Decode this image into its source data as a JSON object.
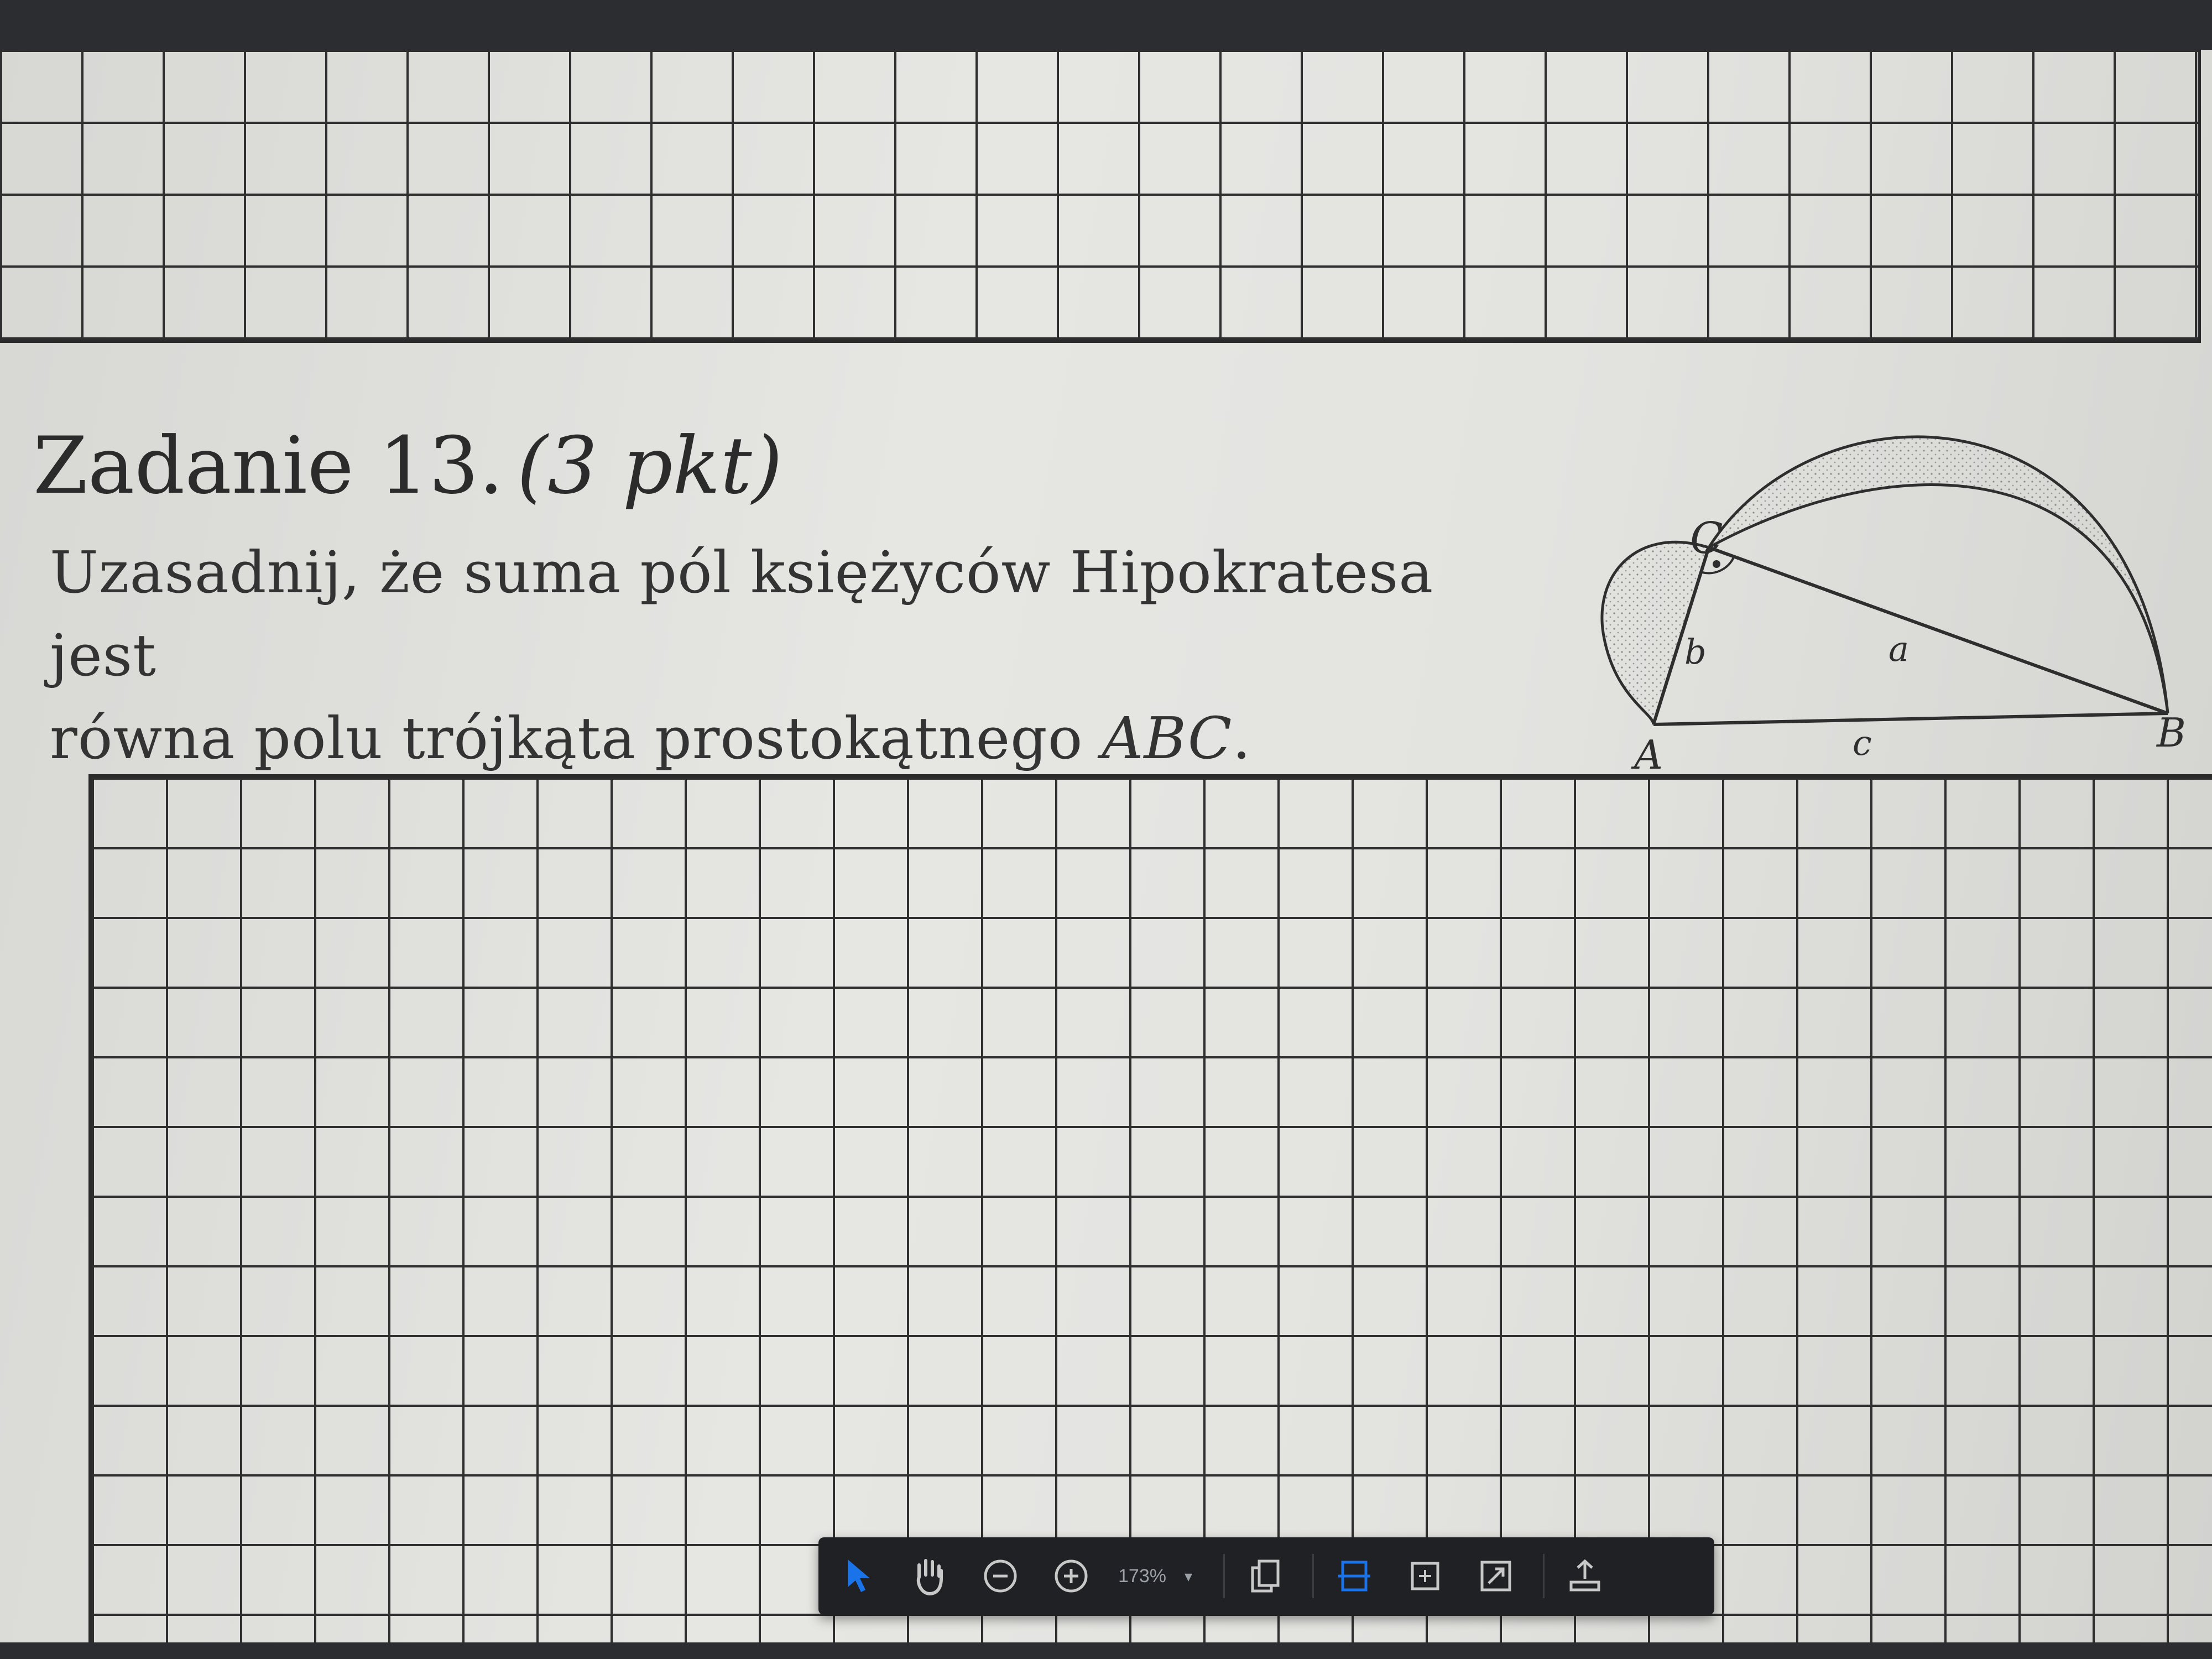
{
  "task": {
    "title": "Zadanie 13.",
    "points": "(3 pkt)",
    "text_line1": "Uzasadnij, że suma pól księżyców Hipokratesa jest",
    "text_line2_prefix": "równa polu trójkąta prostokątnego ",
    "text_line2_math": "ABC",
    "text_line2_suffix": "."
  },
  "figure": {
    "labels": {
      "A": "A",
      "B": "B",
      "C": "C",
      "a": "a",
      "b": "b",
      "c": "c"
    }
  },
  "toolbar": {
    "zoom": "173%",
    "zoom_caret": "▾",
    "icons": [
      "select-pointer-icon",
      "hand-pan-icon",
      "zoom-out-icon",
      "zoom-in-icon",
      "page-copy-icon",
      "fit-width-icon",
      "fit-page-icon",
      "fullscreen-icon",
      "upload-icon"
    ],
    "accent_color": "#1a73e8"
  }
}
